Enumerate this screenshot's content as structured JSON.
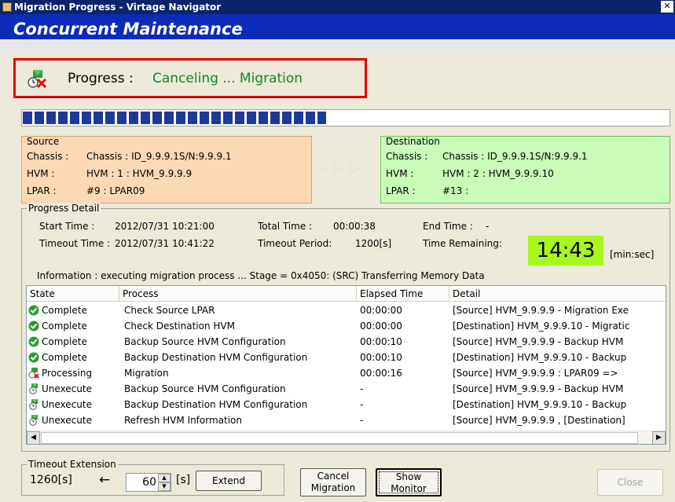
{
  "window": {
    "title": "Migration Progress - Virtage Navigator",
    "close_glyph": "✕"
  },
  "banner": {
    "title": "Concurrent Maintenance"
  },
  "progress": {
    "label": "Progress :",
    "status": "Canceling ...  Migration",
    "fraction": 0.47
  },
  "source": {
    "legend": "Source",
    "rows": [
      {
        "key": "Chassis :",
        "value": "Chassis : ID_9.9.9.1S/N:9.9.9.1"
      },
      {
        "key": "HVM :",
        "value": "HVM : 1 : HVM_9.9.9.9"
      },
      {
        "key": "LPAR :",
        "value": "#9 : LPAR09"
      }
    ]
  },
  "arrows": "▷ ▷ ▷",
  "destination": {
    "legend": "Destination",
    "rows": [
      {
        "key": "Chassis :",
        "value": "Chassis : ID_9.9.9.1S/N:9.9.9.1"
      },
      {
        "key": "HVM :",
        "value": "HVM : 2 : HVM_9.9.9.10"
      },
      {
        "key": "LPAR :",
        "value": "#13 :"
      }
    ]
  },
  "detail": {
    "legend": "Progress Detail",
    "start_label": "Start Time :",
    "start_value": "2012/07/31 10:21:00",
    "total_label": "Total Time :",
    "total_value": "00:00:38",
    "end_label": "End Time :",
    "end_value": "-",
    "timeout_label": "Timeout Time :",
    "timeout_value": "2012/07/31 10:41:22",
    "period_label": "Timeout Period:",
    "period_value": "1200[s]",
    "remaining_label": "Time Remaining:",
    "remaining_value": "14:43",
    "remaining_unit": "[min:sec]",
    "information": "Information :  executing migration process ... Stage = 0x4050: (SRC) Transferring Memory Data"
  },
  "table": {
    "columns": [
      "State",
      "Process",
      "Elapsed Time",
      "Detail"
    ],
    "rows": [
      {
        "icon": "check-icon",
        "state": "Complete",
        "process": "Check Source LPAR",
        "elapsed": "00:00:00",
        "detail": "[Source] HVM_9.9.9.9    - Migration Exe"
      },
      {
        "icon": "check-icon",
        "state": "Complete",
        "process": "Check Destination HVM",
        "elapsed": "00:00:00",
        "detail": "[Destination] HVM_9.9.9.10    - Migratic"
      },
      {
        "icon": "check-icon",
        "state": "Complete",
        "process": "Backup Source HVM Configuration",
        "elapsed": "00:00:10",
        "detail": "[Source] HVM_9.9.9.9    - Backup HVM"
      },
      {
        "icon": "check-icon",
        "state": "Complete",
        "process": "Backup Destination HVM Configuration",
        "elapsed": "00:00:10",
        "detail": "[Destination] HVM_9.9.9.10    - Backup"
      },
      {
        "icon": "processing-icon",
        "state": "Processing",
        "process": "Migration",
        "elapsed": "00:00:16",
        "detail": "[Source] HVM_9.9.9.9    : LPAR09 =>"
      },
      {
        "icon": "pending-icon",
        "state": "Unexecute",
        "process": "Backup Source HVM Configuration",
        "elapsed": "-",
        "detail": "[Source] HVM_9.9.9.9    - Backup HVM"
      },
      {
        "icon": "pending-icon",
        "state": "Unexecute",
        "process": "Backup Destination HVM Configuration",
        "elapsed": "-",
        "detail": "[Destination] HVM_9.9.9.10    - Backup"
      },
      {
        "icon": "pending-icon",
        "state": "Unexecute",
        "process": "Refresh HVM Information",
        "elapsed": "-",
        "detail": "[Source] HVM_9.9.9.9   , [Destination]"
      }
    ]
  },
  "timeout_ext": {
    "legend": "Timeout Extension",
    "current": "1260[s]",
    "arrow": "←",
    "spin_value": "60",
    "unit": "[s]",
    "extend_label": "Extend"
  },
  "buttons": {
    "cancel_line1": "Cancel",
    "cancel_line2": "Migration",
    "show_line1": "Show",
    "show_line2": "Monitor",
    "close": "Close"
  },
  "colors": {
    "banner": "#0d2bb8",
    "status_green": "#18861d",
    "timer_bg": "#a7f91c",
    "source_bg": "#fcd8b4",
    "dest_bg": "#c9fbb9"
  }
}
